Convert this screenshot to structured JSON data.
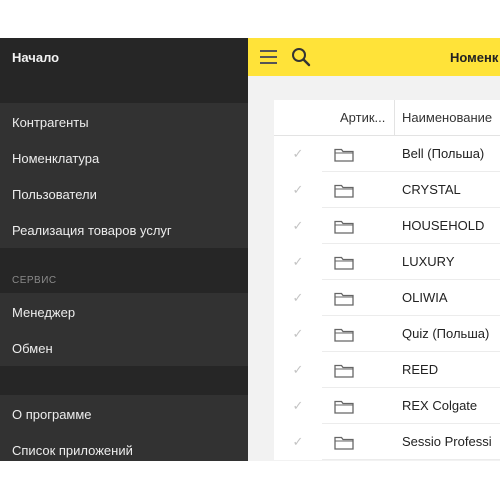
{
  "drawer": {
    "header_title": "Начало",
    "items_group1": [
      "Контрагенты",
      "Номенклатура",
      "Пользователи",
      "Реализация товаров услуг"
    ],
    "section_service": "СЕРВИС",
    "items_group2": [
      "Менеджер",
      "Обмен"
    ],
    "items_group3": [
      "О программе",
      "Список приложений"
    ]
  },
  "toolbar": {
    "title": "Номенк",
    "menu_icon": "hamburger-icon",
    "search_icon": "search-icon",
    "color": "#ffe339"
  },
  "table": {
    "headers": {
      "article": "Артик...",
      "name": "Наименование"
    },
    "rows": [
      {
        "name": "Bell (Польша)"
      },
      {
        "name": "CRYSTAL"
      },
      {
        "name": "HOUSEHOLD"
      },
      {
        "name": "LUXURY"
      },
      {
        "name": "OLIWIA"
      },
      {
        "name": "Quiz (Польша)"
      },
      {
        "name": "REED"
      },
      {
        "name": "REX  Colgate"
      },
      {
        "name": "Sessio Professi"
      }
    ],
    "check_glyph": "✓",
    "row_icon": "folder-icon"
  }
}
